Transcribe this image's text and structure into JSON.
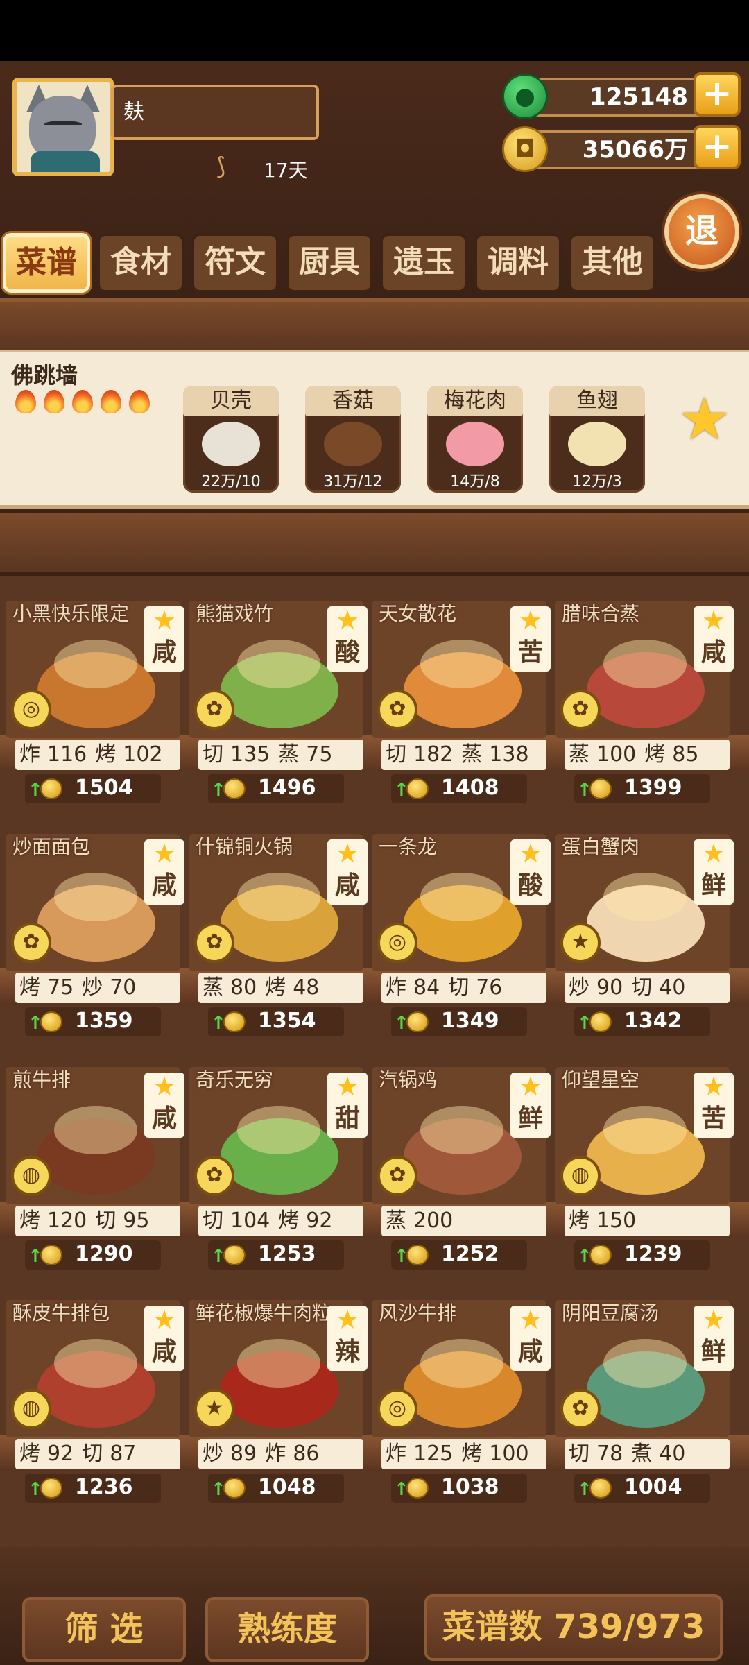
{
  "header": {
    "player_name": "麸",
    "days": "17天",
    "jade": "125148",
    "coins": "35066万",
    "plus_label": "+",
    "back_label": "退"
  },
  "tabs": [
    {
      "label": "菜谱",
      "active": true
    },
    {
      "label": "食材",
      "active": false
    },
    {
      "label": "符文",
      "active": false
    },
    {
      "label": "厨具",
      "active": false
    },
    {
      "label": "遗玉",
      "active": false
    },
    {
      "label": "调料",
      "active": false
    },
    {
      "label": "其他",
      "active": false
    }
  ],
  "selected_recipe": {
    "name": "佛跳墙",
    "flames": 5,
    "ingredients": [
      {
        "name": "贝壳",
        "qty": "22万/10",
        "color": "#e8e2d6"
      },
      {
        "name": "香菇",
        "qty": "31万/12",
        "color": "#7a4a28"
      },
      {
        "name": "梅花肉",
        "qty": "14万/8",
        "color": "#f29aa6"
      },
      {
        "name": "鱼翅",
        "qty": "12万/3",
        "color": "#f2e2b2"
      }
    ],
    "star": "★"
  },
  "recipes": [
    {
      "name": "小黑快乐限定",
      "flavor": "咸",
      "skills": [
        [
          "炸",
          "116"
        ],
        [
          "烤",
          "102"
        ]
      ],
      "price": "1504",
      "tool": "◎",
      "dish_color": "#c9772e"
    },
    {
      "name": "熊猫戏竹",
      "flavor": "酸",
      "skills": [
        [
          "切",
          "135"
        ],
        [
          "蒸",
          "75"
        ]
      ],
      "price": "1496",
      "tool": "✿",
      "dish_color": "#7fb04a"
    },
    {
      "name": "天女散花",
      "flavor": "苦",
      "skills": [
        [
          "切",
          "182"
        ],
        [
          "蒸",
          "138"
        ]
      ],
      "price": "1408",
      "tool": "✿",
      "dish_color": "#e08a3a"
    },
    {
      "name": "腊味合蒸",
      "flavor": "咸",
      "skills": [
        [
          "蒸",
          "100"
        ],
        [
          "烤",
          "85"
        ]
      ],
      "price": "1399",
      "tool": "✿",
      "dish_color": "#b8483a"
    },
    {
      "name": "炒面面包",
      "flavor": "咸",
      "skills": [
        [
          "烤",
          "75"
        ],
        [
          "炒",
          "70"
        ]
      ],
      "price": "1359",
      "tool": "✿",
      "dish_color": "#d79a5a"
    },
    {
      "name": "什锦铜火锅",
      "flavor": "咸",
      "skills": [
        [
          "蒸",
          "80"
        ],
        [
          "烤",
          "48"
        ]
      ],
      "price": "1354",
      "tool": "✿",
      "dish_color": "#d9a23a"
    },
    {
      "name": "一条龙",
      "flavor": "酸",
      "skills": [
        [
          "炸",
          "84"
        ],
        [
          "切",
          "76"
        ]
      ],
      "price": "1349",
      "tool": "◎",
      "dish_color": "#e0a02c"
    },
    {
      "name": "蛋白蟹肉",
      "flavor": "鲜",
      "skills": [
        [
          "炒",
          "90"
        ],
        [
          "切",
          "40"
        ]
      ],
      "price": "1342",
      "tool": "★",
      "dish_color": "#f0d6b0"
    },
    {
      "name": "煎牛排",
      "flavor": "咸",
      "skills": [
        [
          "烤",
          "120"
        ],
        [
          "切",
          "95"
        ]
      ],
      "price": "1290",
      "tool": "◍",
      "dish_color": "#7a3a22"
    },
    {
      "name": "奇乐无穷",
      "flavor": "甜",
      "skills": [
        [
          "切",
          "104"
        ],
        [
          "烤",
          "92"
        ]
      ],
      "price": "1253",
      "tool": "✿",
      "dish_color": "#6ab04a"
    },
    {
      "name": "汽锅鸡",
      "flavor": "鲜",
      "skills": [
        [
          "蒸",
          "200"
        ]
      ],
      "price": "1252",
      "tool": "✿",
      "dish_color": "#a0583a"
    },
    {
      "name": "仰望星空",
      "flavor": "苦",
      "skills": [
        [
          "烤",
          "150"
        ]
      ],
      "price": "1239",
      "tool": "◍",
      "dish_color": "#e8b04a"
    },
    {
      "name": "酥皮牛排包",
      "flavor": "咸",
      "skills": [
        [
          "烤",
          "92"
        ],
        [
          "切",
          "87"
        ]
      ],
      "price": "1236",
      "tool": "◍",
      "dish_color": "#b0402e"
    },
    {
      "name": "鲜花椒爆牛肉粒",
      "flavor": "辣",
      "skills": [
        [
          "炒",
          "89"
        ],
        [
          "炸",
          "86"
        ]
      ],
      "price": "1048",
      "tool": "★",
      "dish_color": "#a8281c"
    },
    {
      "name": "风沙牛排",
      "flavor": "咸",
      "skills": [
        [
          "炸",
          "125"
        ],
        [
          "烤",
          "100"
        ]
      ],
      "price": "1038",
      "tool": "◎",
      "dish_color": "#d8882a"
    },
    {
      "name": "阴阳豆腐汤",
      "flavor": "鲜",
      "skills": [
        [
          "切",
          "78"
        ],
        [
          "煮",
          "40"
        ]
      ],
      "price": "1004",
      "tool": "✿",
      "dish_color": "#5a9a7a"
    }
  ],
  "bottom": {
    "filter_label": "筛 选",
    "mastery_label": "熟练度",
    "count_label": "菜谱数 739/973"
  },
  "colors": {
    "accent_gold": "#f3c35a",
    "price_up_arrow": "#59d64a",
    "tab_active": "#f1b548"
  }
}
